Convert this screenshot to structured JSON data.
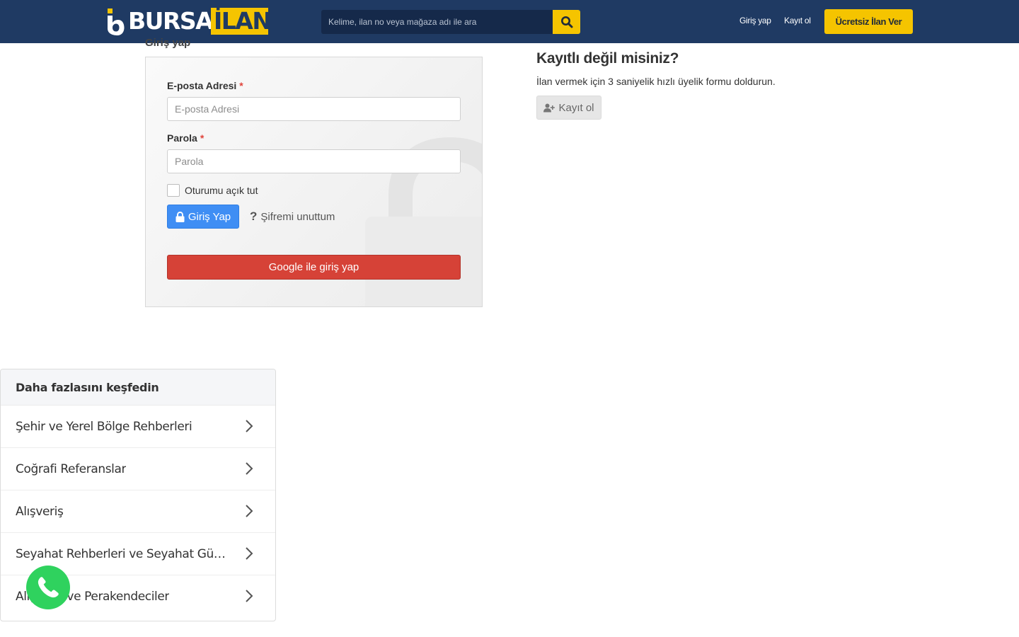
{
  "header": {
    "logo": {
      "part1": "BURSA",
      "part2": "İLAN"
    },
    "search": {
      "placeholder": "Kelime, ilan no veya mağaza adı ile ara",
      "icon": "search-icon"
    },
    "login_link": "Giriş yap",
    "register_link": "Kayıt ol",
    "cta_label": "Ücretsiz İlan Ver",
    "colors": {
      "navy": "#1f3a63",
      "accent": "#f5c400"
    }
  },
  "login": {
    "section_title": "Giriş yap",
    "email_label": "E-posta Adresi",
    "email_placeholder": "E-posta Adresi",
    "password_label": "Parola",
    "password_placeholder": "Parola",
    "required_mark": "*",
    "remember_label": "Oturumu açık tut",
    "remember_checked": false,
    "submit_label": "Giriş Yap",
    "forgot_label": "Şifremi unuttum",
    "google_label": "Google ile giriş yap",
    "colors": {
      "primary": "#3f8ef4",
      "google": "#d64237"
    }
  },
  "register": {
    "title": "Kayıtlı değil misiniz?",
    "description": "İlan vermek için 3 saniyelik hızlı üyelik formu doldurun.",
    "button_label": "Kayıt ol"
  },
  "discover": {
    "title": "Daha fazlasını keşfedin",
    "items": [
      {
        "label": "Şehir ve Yerel Bölge Rehberleri"
      },
      {
        "label": "Coğrafi Referanslar"
      },
      {
        "label": "Alışveriş"
      },
      {
        "label": "Seyahat Rehberleri ve Seyahat Günl..."
      },
      {
        "label": "Alışveriş ve Perakendeciler"
      }
    ]
  },
  "whatsapp": {
    "icon": "whatsapp-icon",
    "color": "#2fd25e"
  }
}
